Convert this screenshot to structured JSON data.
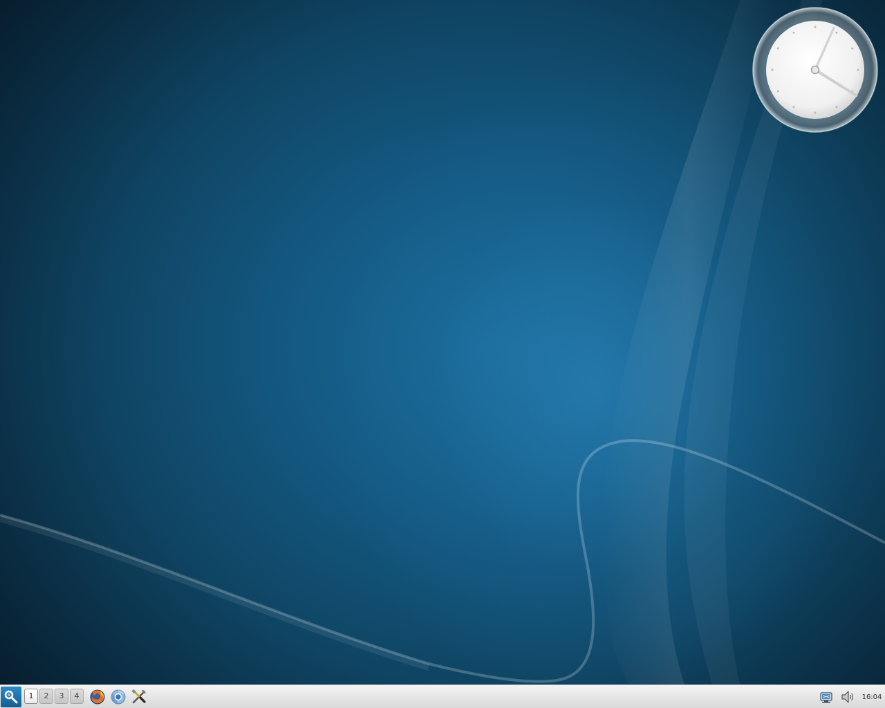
{
  "taskbar": {
    "pager": {
      "desktops": [
        {
          "label": "1",
          "active": true
        },
        {
          "label": "2",
          "active": false
        },
        {
          "label": "3",
          "active": false
        },
        {
          "label": "4",
          "active": false
        }
      ]
    },
    "quick_launch": [
      {
        "icon": "firefox-icon"
      },
      {
        "icon": "chromium-icon"
      },
      {
        "icon": "system-settings-icon"
      }
    ],
    "tray": {
      "icons": [
        "network-icon",
        "volume-icon"
      ],
      "clock": "16:04"
    }
  },
  "clock_widget": {
    "hour": 16,
    "minute": 4
  },
  "colors": {
    "wallpaper_center": "#1a6a98",
    "wallpaper_edge": "#071d2c",
    "launcher": "#1f78b0",
    "taskbar": "#e6e6e6"
  }
}
